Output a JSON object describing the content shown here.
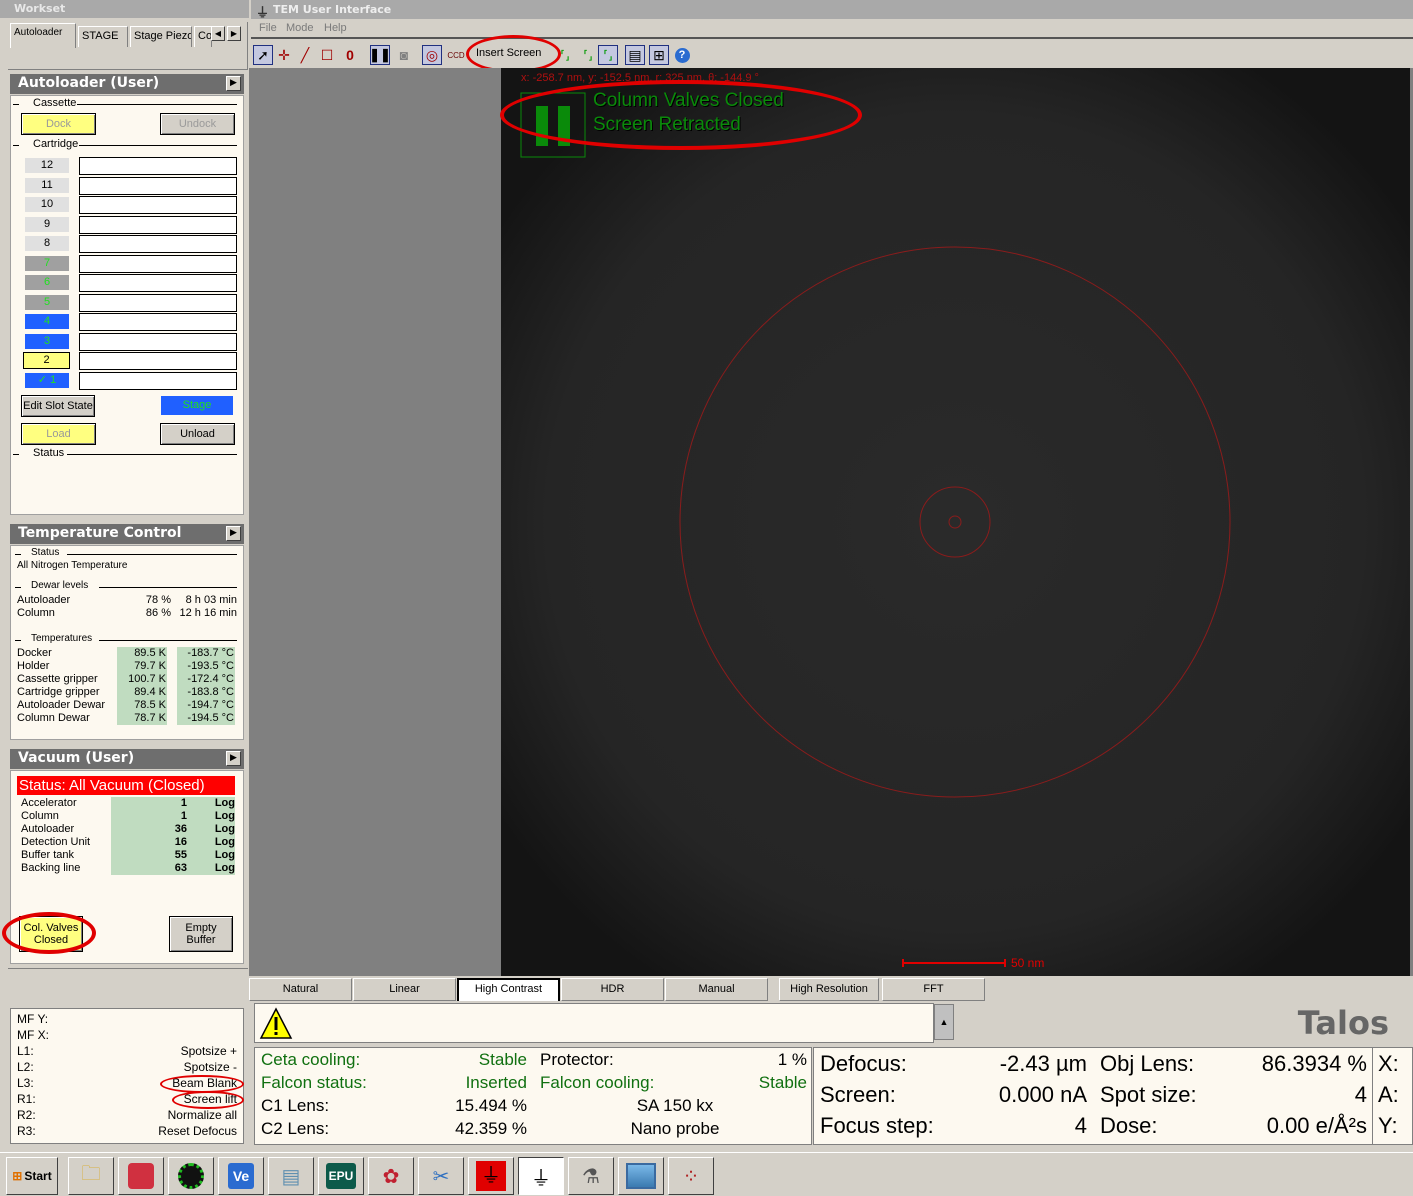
{
  "workset": {
    "title": "Workset",
    "tabs": [
      "Autoloader",
      "STAGE",
      "Stage Piezo",
      "Co"
    ],
    "scroll_left": "◀",
    "scroll_right": "▶"
  },
  "autoloader": {
    "title": "Autoloader (User)",
    "cassette_label": "Cassette",
    "dock_label": "Dock",
    "undock_label": "Undock",
    "cartridge_label": "Cartridge",
    "slots": [
      {
        "num": "12",
        "state": "empty",
        "bg": "#e0e0e0",
        "fg": "#000000"
      },
      {
        "num": "11",
        "state": "empty",
        "bg": "#e0e0e0",
        "fg": "#000000"
      },
      {
        "num": "10",
        "state": "empty",
        "bg": "#e0e0e0",
        "fg": "#000000"
      },
      {
        "num": "9",
        "state": "empty",
        "bg": "#e0e0e0",
        "fg": "#000000"
      },
      {
        "num": "8",
        "state": "empty",
        "bg": "#e0e0e0",
        "fg": "#000000"
      },
      {
        "num": "7",
        "state": "occupied",
        "bg": "#a0a0a0",
        "fg": "#20e020"
      },
      {
        "num": "6",
        "state": "occupied",
        "bg": "#a0a0a0",
        "fg": "#20e020"
      },
      {
        "num": "5",
        "state": "occupied",
        "bg": "#a0a0a0",
        "fg": "#20e020"
      },
      {
        "num": "4",
        "state": "loaded",
        "bg": "#2060ff",
        "fg": "#20e020"
      },
      {
        "num": "3",
        "state": "loaded",
        "bg": "#2060ff",
        "fg": "#20e020"
      },
      {
        "num": "2",
        "state": "selected",
        "bg": "#ffff80",
        "fg": "#000000"
      },
      {
        "num": "✓ 1",
        "state": "on-stage",
        "bg": "#2060ff",
        "fg": "#20e020"
      }
    ],
    "edit_slot_label": "Edit Slot State",
    "stage_label": "Stage",
    "load_label": "Load",
    "unload_label": "Unload",
    "status_label": "Status"
  },
  "temperature": {
    "title": "Temperature Control",
    "status_label": "Status",
    "status_text": "All Nitrogen Temperature",
    "dewar_label": "Dewar levels",
    "dewars": [
      {
        "name": "Autoloader",
        "level": "78 %",
        "time": "8 h 03 min"
      },
      {
        "name": "Column",
        "level": "86 %",
        "time": "12 h 16 min"
      }
    ],
    "temps_label": "Temperatures",
    "temps": [
      {
        "name": "Docker",
        "k": "89.5 K",
        "c": "-183.7 °C"
      },
      {
        "name": "Holder",
        "k": "79.7 K",
        "c": "-193.5 °C"
      },
      {
        "name": "Cassette gripper",
        "k": "100.7 K",
        "c": "-172.4 °C"
      },
      {
        "name": "Cartridge gripper",
        "k": "89.4 K",
        "c": "-183.8 °C"
      },
      {
        "name": "Autoloader Dewar",
        "k": "78.5 K",
        "c": "-194.7 °C"
      },
      {
        "name": "Column Dewar",
        "k": "78.7 K",
        "c": "-194.5 °C"
      }
    ]
  },
  "vacuum": {
    "title": "Vacuum (User)",
    "status": "Status: All Vacuum (Closed)",
    "rows": [
      {
        "name": "Accelerator",
        "value": "1",
        "unit": "Log"
      },
      {
        "name": "Column",
        "value": "1",
        "unit": "Log"
      },
      {
        "name": "Autoloader",
        "value": "36",
        "unit": "Log"
      },
      {
        "name": "Detection Unit",
        "value": "16",
        "unit": "Log"
      },
      {
        "name": "Buffer tank",
        "value": "55",
        "unit": "Log"
      },
      {
        "name": "Backing line",
        "value": "63",
        "unit": "Log"
      }
    ],
    "col_valves_line1": "Col. Valves",
    "col_valves_line2": "Closed",
    "empty_buffer_line1": "Empty",
    "empty_buffer_line2": "Buffer"
  },
  "shortcuts": [
    {
      "key": "MF Y:",
      "action": ""
    },
    {
      "key": "MF X:",
      "action": ""
    },
    {
      "key": "L1:",
      "action": "Spotsize +"
    },
    {
      "key": "L2:",
      "action": "Spotsize -"
    },
    {
      "key": "L3:",
      "action": "Beam Blank"
    },
    {
      "key": "R1:",
      "action": "Screen lift"
    },
    {
      "key": "R2:",
      "action": "Normalize all"
    },
    {
      "key": "R3:",
      "action": "Reset Defocus"
    }
  ],
  "app": {
    "title": "TEM User Interface",
    "menu": [
      "File",
      "Mode",
      "Help"
    ],
    "insert_screen_label": "Insert Screen",
    "ccd_label": "CCD"
  },
  "image": {
    "coord_readout": "x: -258.7 nm, y: -152.5 nm, r: 325 nm, θ: -144.9 °",
    "status_line1": "Column Valves Closed",
    "status_line2": "Screen Retracted",
    "scale_label": "50 nm"
  },
  "contrast_tabs": [
    "Natural",
    "Linear",
    "High Contrast",
    "HDR",
    "Manual",
    "High Resolution",
    "FFT"
  ],
  "contrast_active": "High Contrast",
  "brand": "Talos",
  "camera_status": {
    "ceta_label": "Ceta cooling:",
    "ceta_value": "Stable",
    "protector_label": "Protector:",
    "protector_value": "1 %",
    "falcon_status_label": "Falcon status:",
    "falcon_status_value": "Inserted",
    "falcon_cooling_label": "Falcon cooling:",
    "falcon_cooling_value": "Stable",
    "c1_label": "C1 Lens:",
    "c1_value": "15.494 %",
    "mag": "SA 150 kx",
    "c2_label": "C2 Lens:",
    "c2_value": "42.359 %",
    "probe": "Nano probe"
  },
  "optics_status": {
    "defocus_label": "Defocus:",
    "defocus_value": "-2.43 µm",
    "objlens_label": "Obj Lens:",
    "objlens_value": "86.3934 %",
    "screen_label": "Screen:",
    "screen_value": "0.000 nA",
    "spot_label": "Spot size:",
    "spot_value": "4",
    "focusstep_label": "Focus step:",
    "focusstep_value": "4",
    "dose_label": "Dose:",
    "dose_value": "0.00 e/Å²s",
    "x_label": "X:",
    "a_label": "A:",
    "y_label": "Y:"
  },
  "taskbar": {
    "start_label": "Start",
    "apps": [
      "file-explorer",
      "red-cube-app",
      "green-dot-app",
      "Ve",
      "window-app",
      "EPU",
      "molecule-app",
      "snipping-tool",
      "tem-red",
      "tem-ui",
      "microscope-app",
      "image-viewer",
      "diffraction-app"
    ]
  }
}
